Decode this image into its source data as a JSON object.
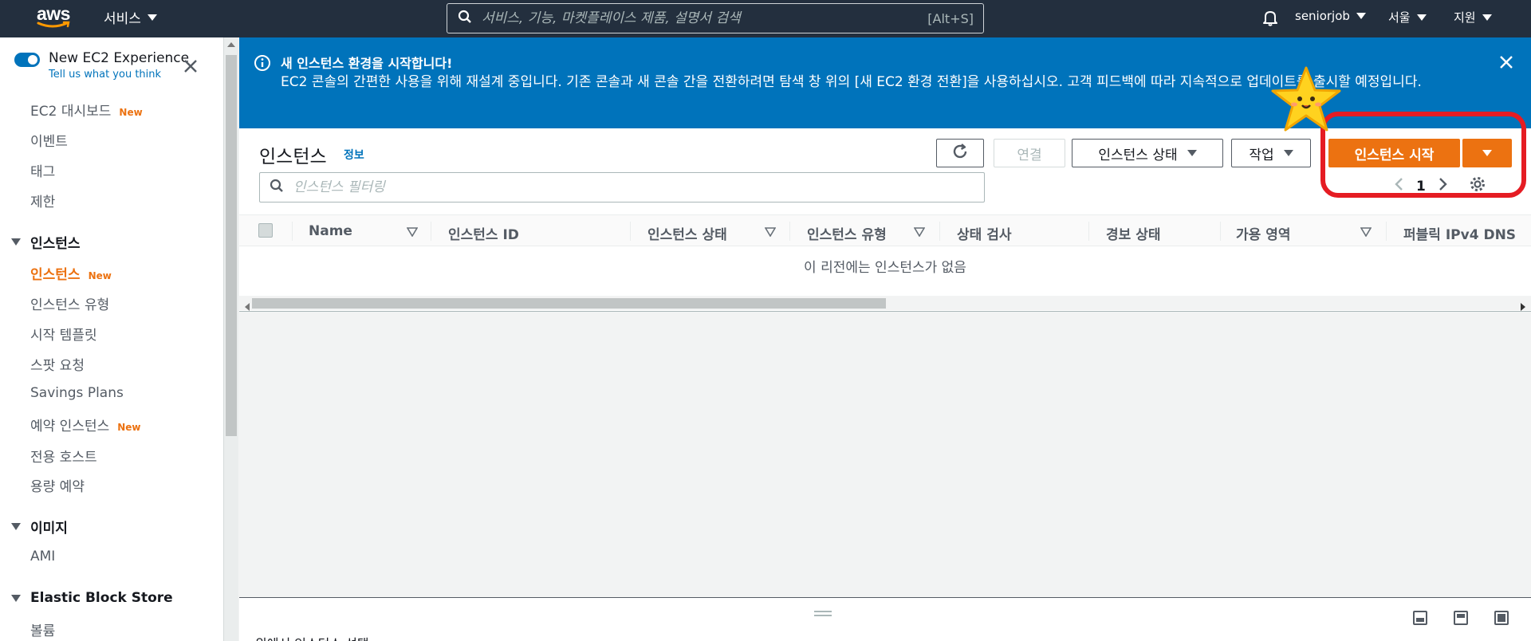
{
  "topnav": {
    "logo_text": "aws",
    "services_label": "서비스",
    "search_placeholder": "서비스, 기능, 마켓플레이스 제품, 설명서 검색",
    "search_shortcut": "[Alt+S]",
    "account": "seniorjob",
    "region": "서울",
    "support": "지원"
  },
  "sidebar": {
    "experience_title": "New EC2 Experience",
    "experience_sub": "Tell us what you think",
    "badge_new": "New",
    "items": [
      {
        "label": "EC2 대시보드",
        "new": true
      },
      {
        "label": "이벤트"
      },
      {
        "label": "태그"
      },
      {
        "label": "제한"
      }
    ],
    "section_instances": "인스턴스",
    "instances_items": [
      {
        "label": "인스턴스",
        "new": true,
        "active": true
      },
      {
        "label": "인스턴스 유형"
      },
      {
        "label": "시작 템플릿"
      },
      {
        "label": "스팟 요청"
      },
      {
        "label": "Savings Plans"
      },
      {
        "label": "예약 인스턴스",
        "new": true
      },
      {
        "label": "전용 호스트"
      },
      {
        "label": "용량 예약"
      }
    ],
    "section_images": "이미지",
    "images_items": [
      {
        "label": "AMI"
      }
    ],
    "section_ebs": "Elastic Block Store",
    "ebs_items": [
      {
        "label": "볼륨"
      }
    ]
  },
  "flash": {
    "title": "새 인스턴스 환경을 시작합니다!",
    "body": "EC2 콘솔의 간편한 사용을 위해 재설계 중입니다. 기존 콘솔과 새 콘솔 간을 전환하려면 탐색 창 위의 [새 EC2 환경 전환]을 사용하십시오. 고객 피드백에 따라 지속적으로 업데이트를 출시할 예정입니다."
  },
  "panel": {
    "title": "인스턴스",
    "info_link": "정보",
    "btn_connect": "연결",
    "btn_state": "인스턴스 상태",
    "btn_actions": "작업",
    "btn_launch": "인스턴스 시작",
    "filter_placeholder": "인스턴스 필터링",
    "page_number": "1",
    "columns": [
      "Name",
      "인스턴스 ID",
      "인스턴스 상태",
      "인스턴스 유형",
      "상태 검사",
      "경보 상태",
      "가용 영역",
      "퍼블릭 IPv4 DNS"
    ],
    "empty_message": "이 리전에는 인스턴스가 없음"
  },
  "split": {
    "status_text": "위에서 인스턴스 선택"
  },
  "colors": {
    "nav_bg": "#232f3e",
    "flash_bg": "#0073bb",
    "accent": "#ec7211",
    "highlight": "#e51c23"
  }
}
